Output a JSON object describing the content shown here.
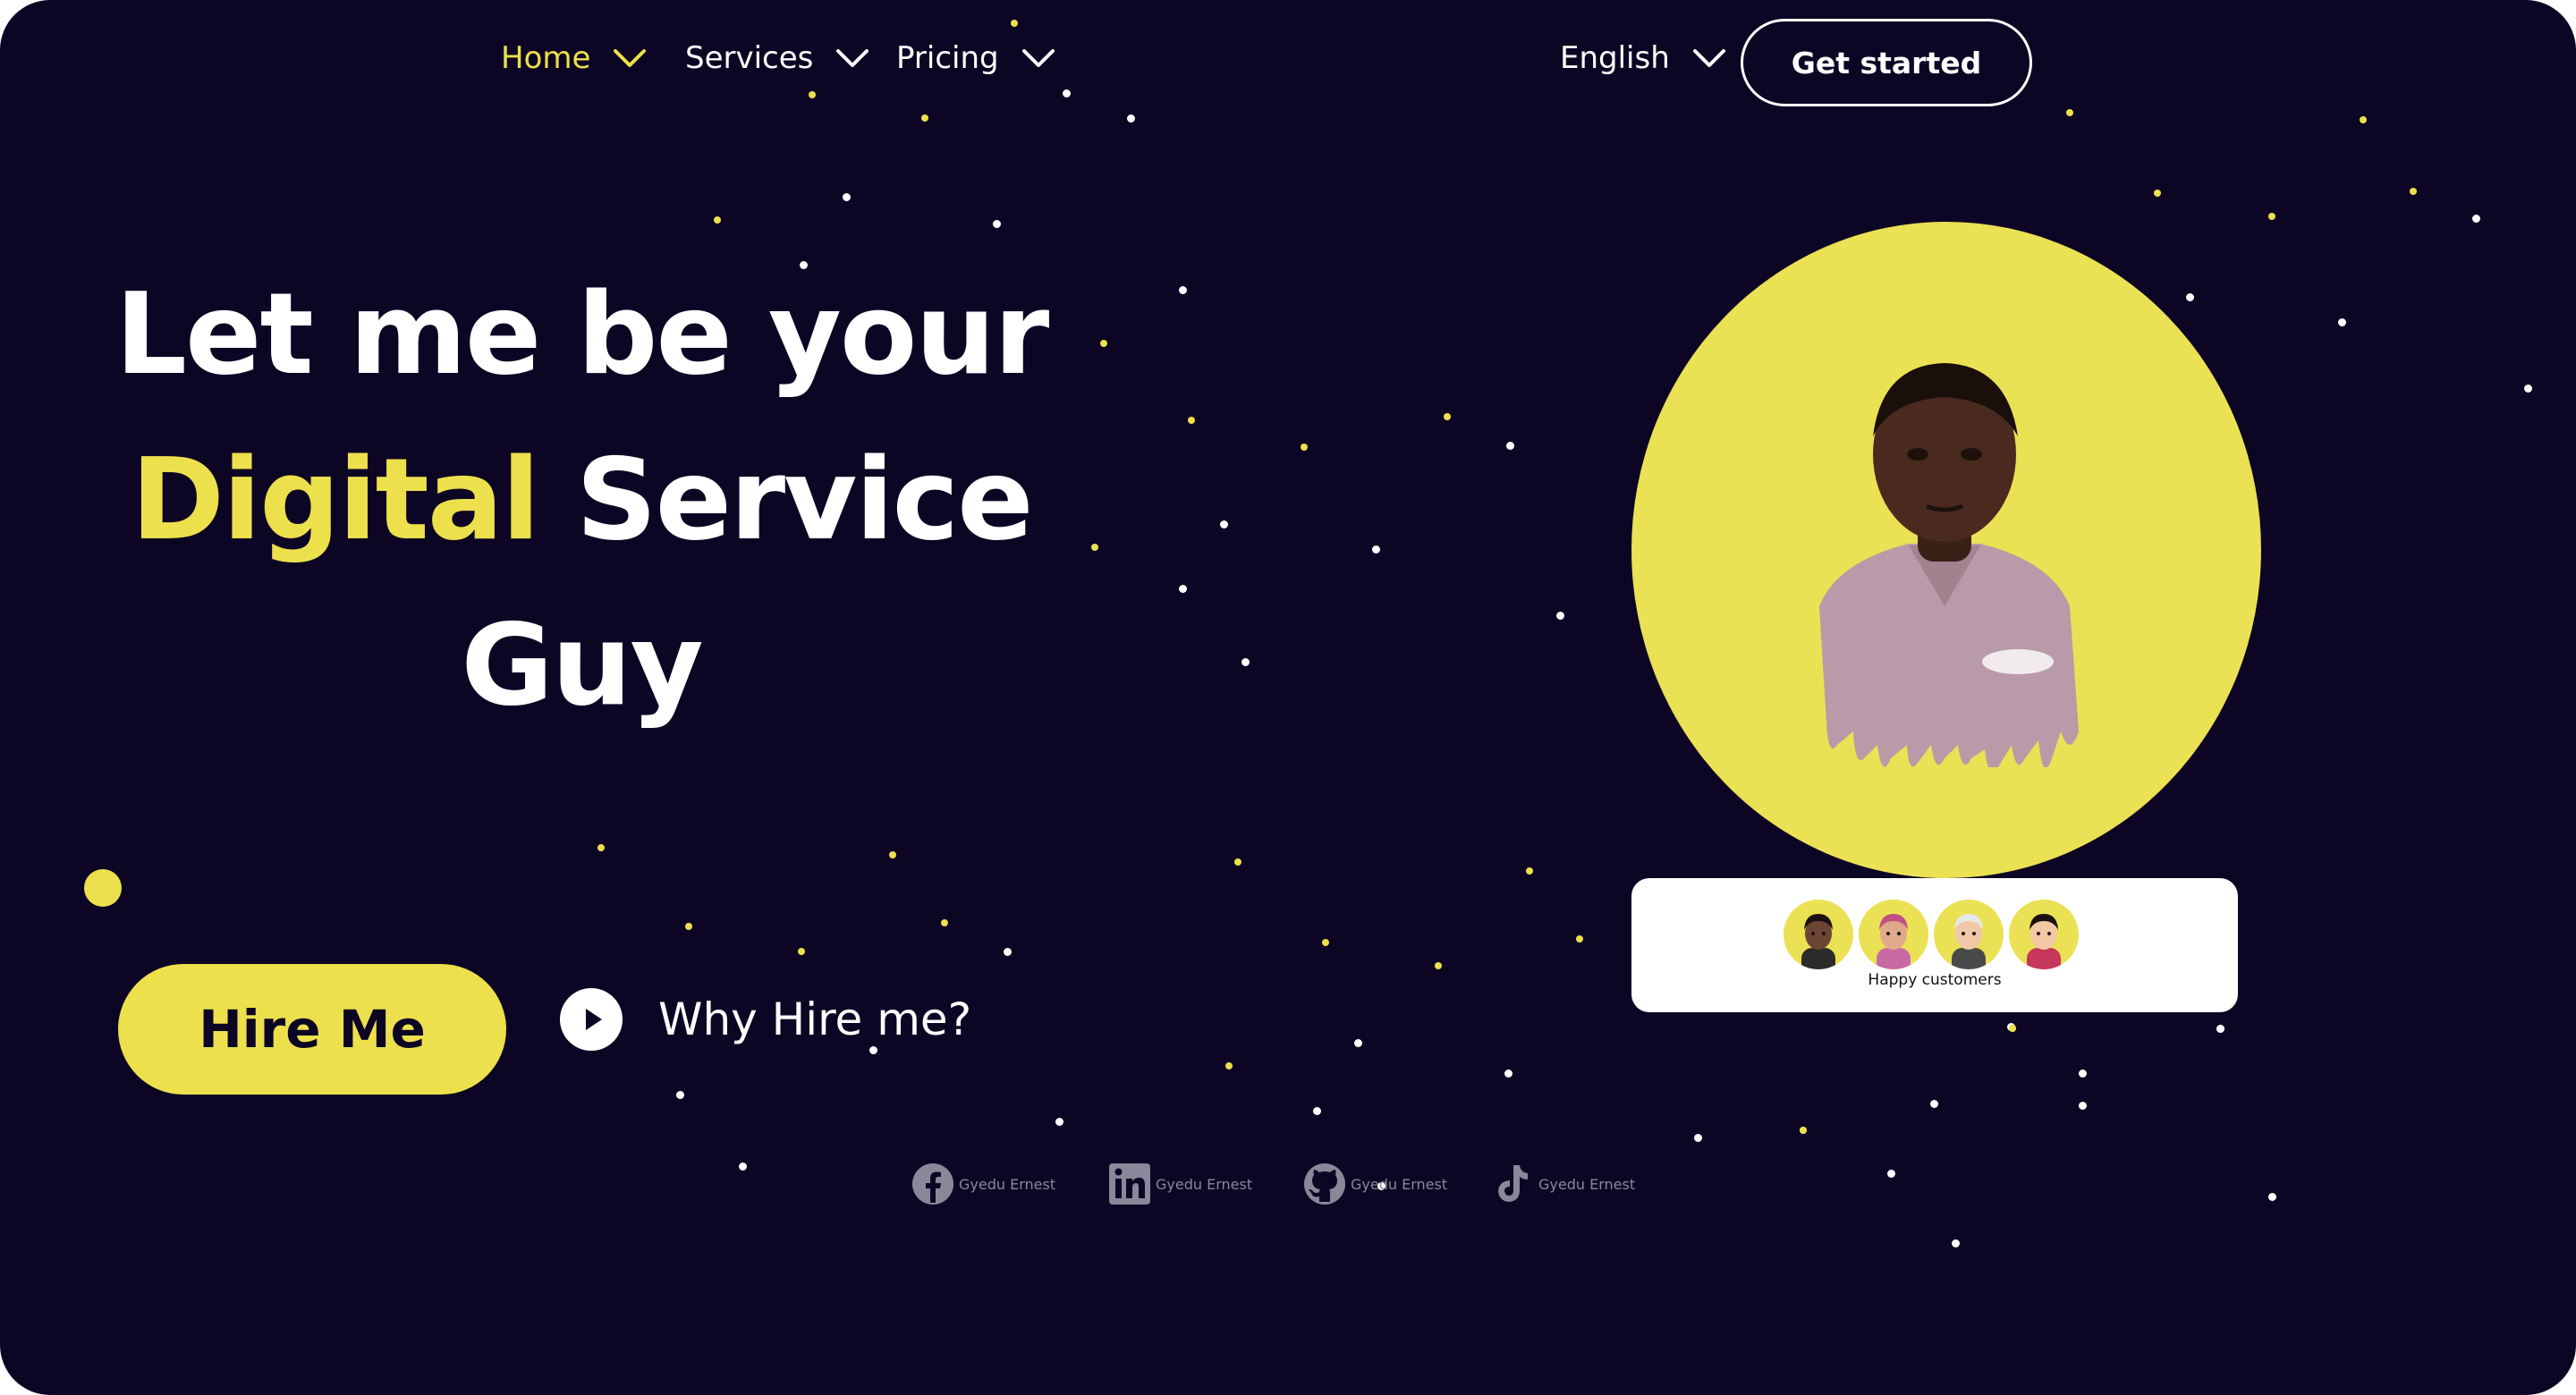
{
  "nav": {
    "items": [
      {
        "label": "Home",
        "active": true
      },
      {
        "label": "Services",
        "active": false
      },
      {
        "label": "Pricing",
        "active": false
      }
    ],
    "language": "English",
    "cta_label": "Get started"
  },
  "hero": {
    "line1": "Let me be your",
    "line2_accent": "Digital",
    "line2_rest": "Service",
    "line3": "Guy"
  },
  "actions": {
    "hire_label": "Hire Me",
    "why_label": "Why Hire me?"
  },
  "portrait": {
    "customers_label": "Happy customers",
    "avatar_count": 4
  },
  "socials": [
    {
      "icon": "facebook-icon",
      "label": "Gyedu Ernest"
    },
    {
      "icon": "linkedin-icon",
      "label": "Gyedu Ernest"
    },
    {
      "icon": "github-icon",
      "label": "Gyedu Ernest"
    },
    {
      "icon": "tiktok-icon",
      "label": "Gyedu Ernest"
    }
  ],
  "colors": {
    "background": "#0d0524",
    "accent": "#ede04d",
    "text": "#ffffff",
    "muted": "#8b8798"
  }
}
